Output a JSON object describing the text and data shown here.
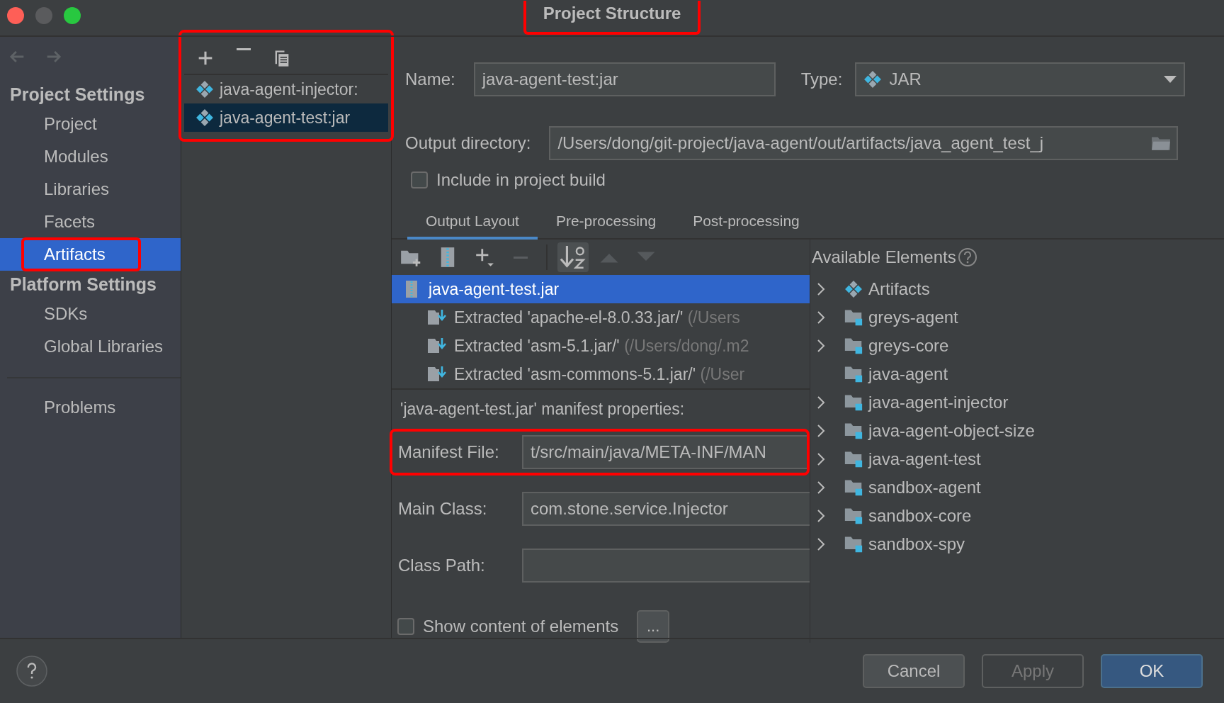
{
  "window": {
    "title": "Project Structure",
    "highlighted": true
  },
  "sidebar": {
    "sections": [
      {
        "heading": "Project Settings",
        "items": [
          {
            "label": "Project",
            "selected": false,
            "highlighted": false
          },
          {
            "label": "Modules",
            "selected": false,
            "highlighted": false
          },
          {
            "label": "Libraries",
            "selected": false,
            "highlighted": false
          },
          {
            "label": "Facets",
            "selected": false,
            "highlighted": false
          },
          {
            "label": "Artifacts",
            "selected": true,
            "highlighted": true
          }
        ]
      },
      {
        "heading": "Platform Settings",
        "items": [
          {
            "label": "SDKs",
            "selected": false,
            "highlighted": false
          },
          {
            "label": "Global Libraries",
            "selected": false,
            "highlighted": false
          }
        ]
      }
    ],
    "extra_items": [
      {
        "label": "Problems",
        "selected": false
      }
    ]
  },
  "artifacts": {
    "highlighted": true,
    "items": [
      {
        "label": "java-agent-injector:",
        "selected": false
      },
      {
        "label": "java-agent-test:jar",
        "selected": true
      }
    ]
  },
  "form": {
    "name_label": "Name:",
    "name": "java-agent-test:jar",
    "type_label": "Type:",
    "type": "JAR",
    "output_label": "Output directory:",
    "output": "/Users/dong/git-project/java-agent/out/artifacts/java_agent_test_j",
    "include": {
      "label": "Include in project build",
      "checked": false
    }
  },
  "tabs": [
    {
      "label": "Output Layout",
      "selected": true
    },
    {
      "label": "Pre-processing",
      "selected": false
    },
    {
      "label": "Post-processing",
      "selected": false
    }
  ],
  "tree": {
    "label": "java-agent-test.jar",
    "selected": true,
    "children": [
      {
        "label": "Extracted 'apache-el-8.0.33.jar/'",
        "detail": "(/Users"
      },
      {
        "label": "Extracted 'asm-5.1.jar/'",
        "detail": "(/Users/dong/.m2"
      },
      {
        "label": "Extracted 'asm-commons-5.1.jar/'",
        "detail": "(/User"
      }
    ]
  },
  "manifest": {
    "heading": "'java-agent-test.jar' manifest properties:",
    "fields": [
      {
        "label": "Manifest File:",
        "value": "t/src/main/java/META-INF/MAN",
        "highlighted": true
      },
      {
        "label": "Main Class:",
        "value": "com.stone.service.Injector",
        "highlighted": false
      },
      {
        "label": "Class Path:",
        "highlighted": false
      }
    ]
  },
  "show_content": {
    "label": "Show content of elements",
    "checked": false
  },
  "more_button": "...",
  "available": {
    "title": "Available Elements",
    "items": [
      {
        "label": "Artifacts",
        "kind": "artifact",
        "expandable": true
      },
      {
        "label": "greys-agent",
        "kind": "module",
        "expandable": true
      },
      {
        "label": "greys-core",
        "kind": "module",
        "expandable": true
      },
      {
        "label": "java-agent",
        "kind": "module",
        "expandable": false
      },
      {
        "label": "java-agent-injector",
        "kind": "module",
        "expandable": true
      },
      {
        "label": "java-agent-object-size",
        "kind": "module",
        "expandable": true
      },
      {
        "label": "java-agent-test",
        "kind": "module",
        "expandable": true
      },
      {
        "label": "sandbox-agent",
        "kind": "module",
        "expandable": true
      },
      {
        "label": "sandbox-core",
        "kind": "module",
        "expandable": true
      },
      {
        "label": "sandbox-spy",
        "kind": "module",
        "expandable": true
      }
    ]
  },
  "footer": {
    "buttons": [
      {
        "label": "Cancel",
        "kind": "normal"
      },
      {
        "label": "Apply",
        "kind": "disabled"
      },
      {
        "label": "OK",
        "kind": "default"
      }
    ]
  }
}
